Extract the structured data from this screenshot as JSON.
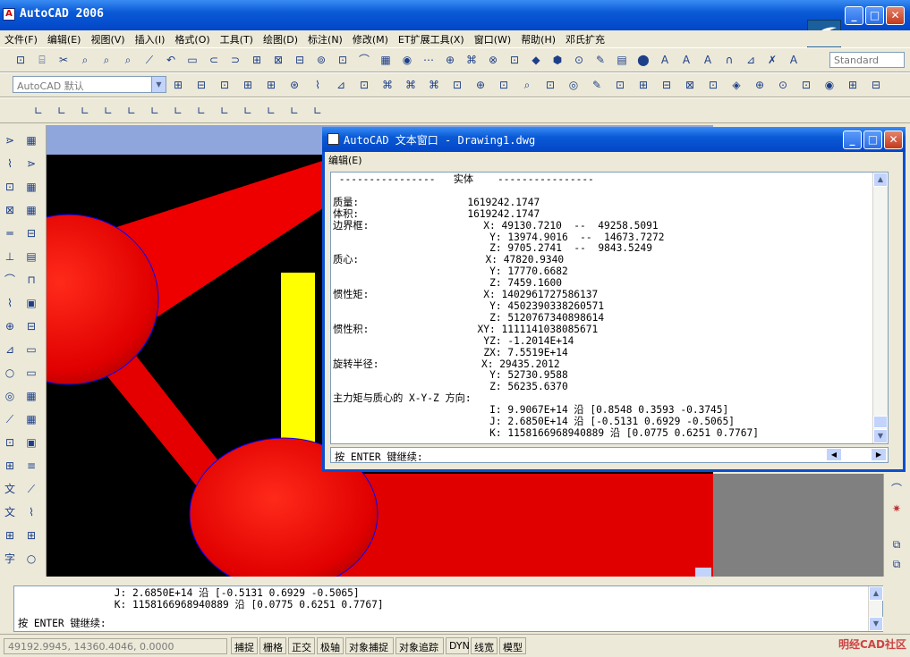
{
  "app": {
    "title": "AutoCAD 2006",
    "icon_label": "A"
  },
  "window_buttons": {
    "minimize": "_",
    "maximize": "□",
    "close": "✕"
  },
  "menu": [
    "文件(F)",
    "编辑(E)",
    "视图(V)",
    "插入(I)",
    "格式(O)",
    "工具(T)",
    "绘图(D)",
    "标注(N)",
    "修改(M)",
    "ET扩展工具(X)",
    "窗口(W)",
    "帮助(H)",
    "邓氏扩充"
  ],
  "toolbar": {
    "text_style_value": "Standard",
    "layer_value": "AutoCAD 默认",
    "icons_row1": [
      "⊡",
      "⌸",
      "✂",
      "⌕",
      "⌕",
      "⌕",
      "⟋",
      "↶",
      "▭",
      "⊂",
      "⊃",
      "⊞",
      "⊠",
      "⊟",
      "⊚",
      "⊡",
      "⌒",
      "▦",
      "◉",
      "⋯",
      "⊕",
      "⌘",
      "⊗",
      "⊡",
      "◆",
      "⬢",
      "⊙",
      "✎",
      "▤",
      "⬤",
      "A",
      "A",
      "A",
      "∩",
      "⊿",
      "✗",
      "Ａ"
    ],
    "icons_row2": [
      "⊞",
      "⊟",
      "⊡",
      "⊞",
      "⊞",
      "⊛",
      "⌇",
      "⊿",
      "⊡",
      "⌘",
      "⌘",
      "⌘",
      "⊡",
      "⊕",
      "⊡",
      "⌕",
      "⊡",
      "◎",
      "✎",
      "⊡",
      "⊞",
      "⊟",
      "⊠",
      "⊡",
      "◈",
      "⊕",
      "⊙",
      "⊡",
      "◉",
      "⊞",
      "⊟"
    ],
    "icons_row3": [
      "∟",
      "∟",
      "∟",
      "∟",
      "∟",
      "∟",
      "∟",
      "∟",
      "∟",
      "∟",
      "∟",
      "∟",
      "∟"
    ],
    "combo_arrow": "▼"
  },
  "text_window": {
    "title": "AutoCAD 文本窗口 - Drawing1.dwg",
    "menu_label": "编辑(E)",
    "lines": [
      " ----------------   实体    ----------------",
      "",
      "质量:                  1619242.1747",
      "体积:                  1619242.1747",
      "边界框:                   X: 49130.7210  --  49258.5091",
      "                          Y: 13974.9016  --  14673.7272",
      "                          Z: 9705.2741  --  9843.5249",
      "质心:                     X: 47820.9340",
      "                          Y: 17770.6682",
      "                          Z: 7459.1600",
      "惯性矩:                   X: 1402961727586137",
      "                          Y: 4502390338260571",
      "                          Z: 5120767340898614",
      "惯性积:                  XY: 1111141038085671",
      "                         YZ: -1.2014E+14",
      "                         ZX: 7.5519E+14",
      "旋转半径:                 X: 29435.2012",
      "                          Y: 52730.9588",
      "                          Z: 56235.6370",
      "主力矩与质心的 X-Y-Z 方向:",
      "                          I: 9.9067E+14 沿 [0.8548 0.3593 -0.3745]",
      "                          J: 2.6850E+14 沿 [-0.5131 0.6929 -0.5065]",
      "                          K: 1158166968940889 沿 [0.0775 0.6251 0.7767]"
    ],
    "prompt": "按 ENTER 键继续:",
    "scroll_up": "▲",
    "scroll_down": "▼",
    "scroll_left": "◀",
    "scroll_right": "▶"
  },
  "command_line": {
    "lines": [
      "                J: 2.6850E+14 沿 [-0.5131 0.6929 -0.5065]",
      "                K: 1158166968940889 沿 [0.0775 0.6251 0.7767]"
    ],
    "prompt": "按 ENTER 键继续:"
  },
  "status": {
    "coords": "49192.9945, 14360.4046, 0.0000",
    "modes": [
      "捕捉",
      "栅格",
      "正交",
      "极轴",
      "对象捕捉",
      "对象追踪",
      "DYN",
      "线宽",
      "模型"
    ],
    "watermark": "明经CAD社区"
  },
  "colors": {
    "titlebar": "#0a5ad6",
    "solid_red": "#ff0000",
    "highlight_yellow": "#ffff00",
    "canvas_bg": "#000000"
  }
}
